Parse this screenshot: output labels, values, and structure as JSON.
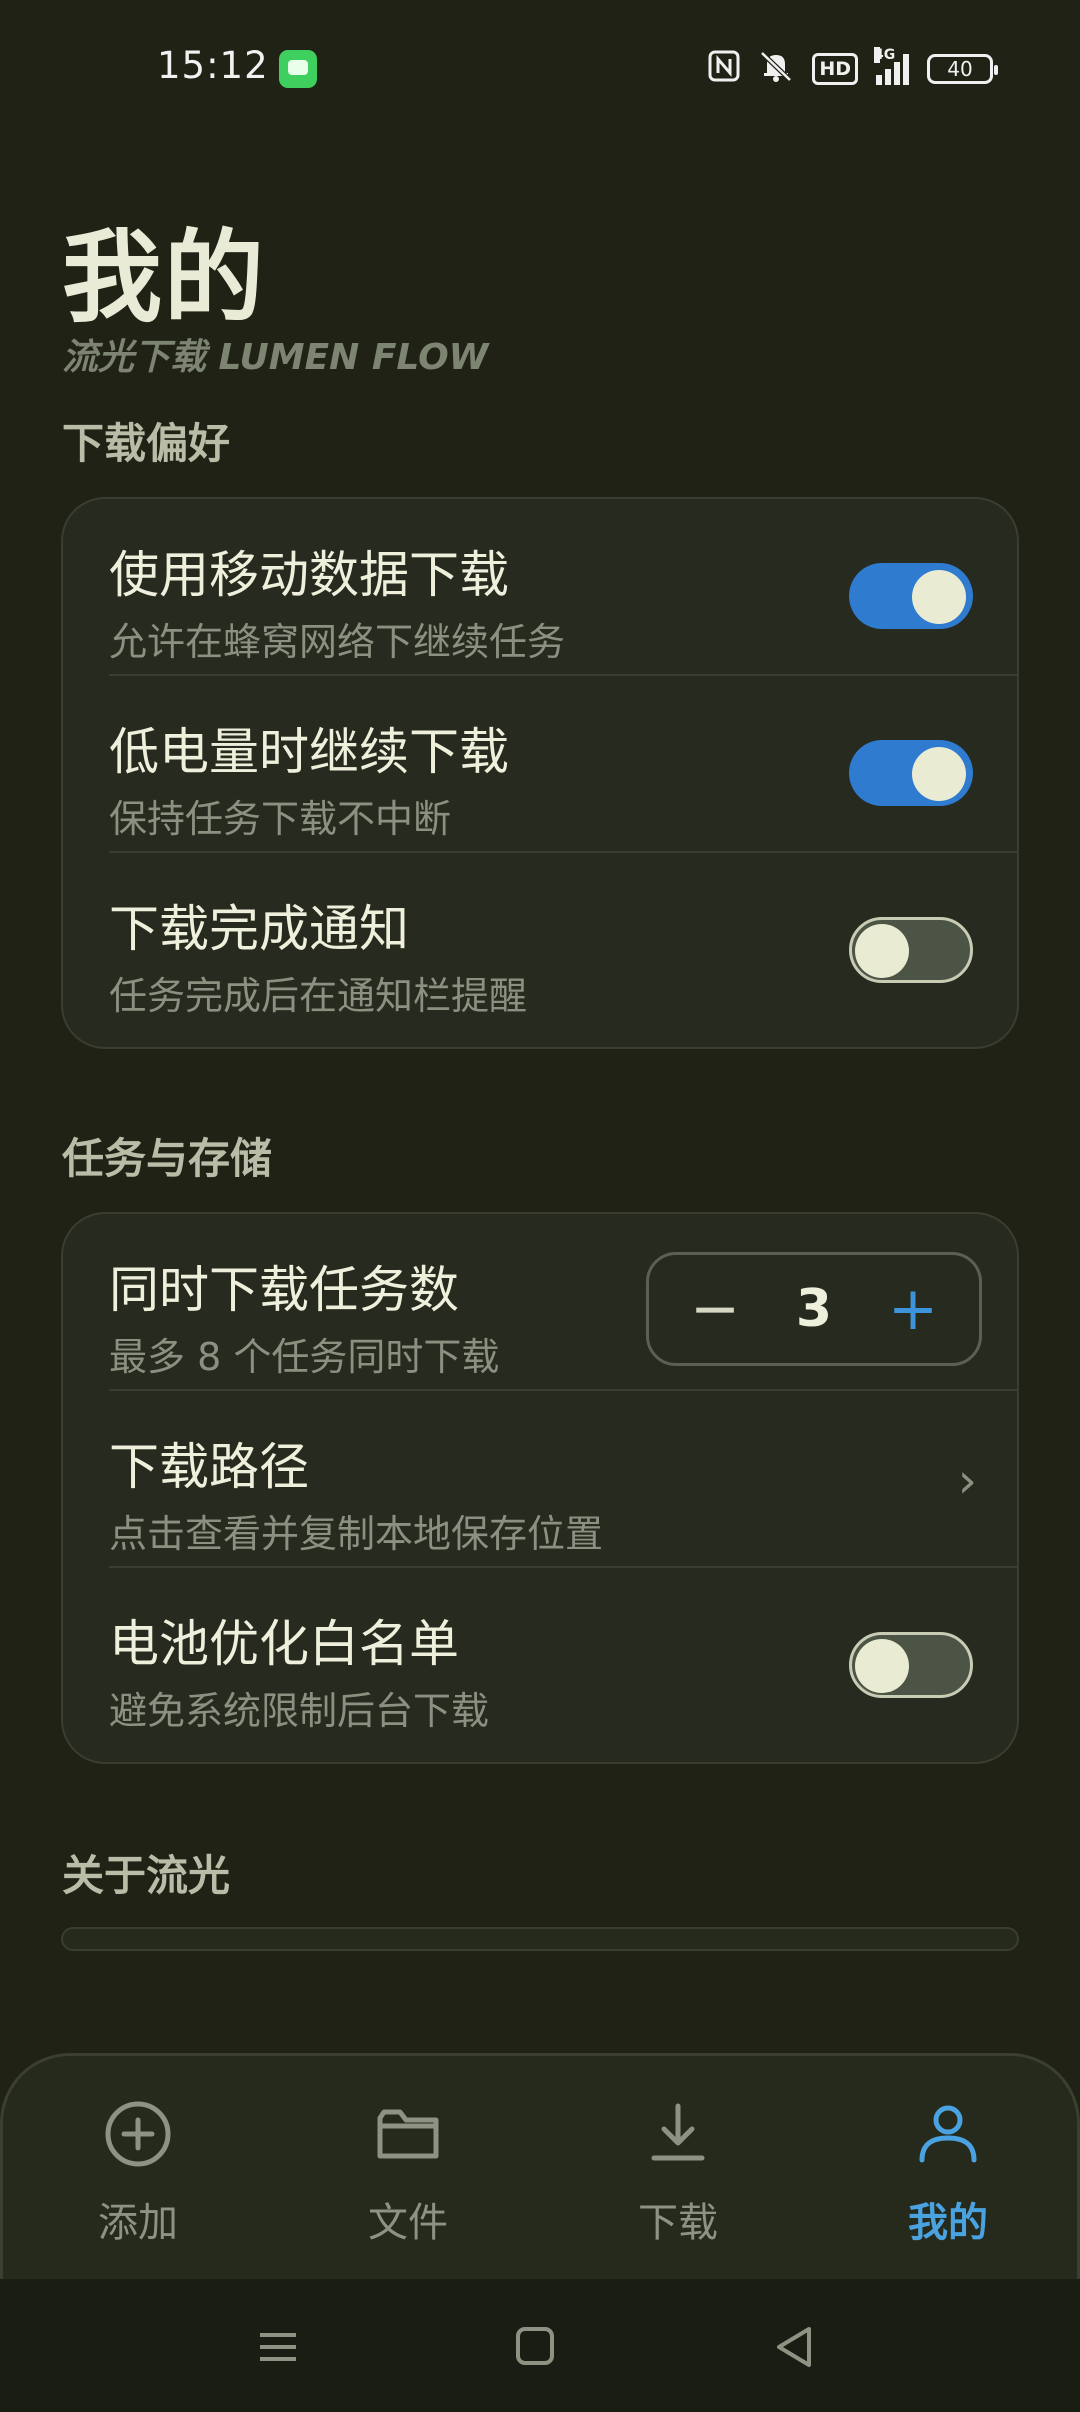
{
  "status_bar": {
    "time": "15:12",
    "hd": "HD",
    "network": "4G",
    "battery": "40"
  },
  "header": {
    "title": "我的",
    "subtitle": "流光下载  LUMEN FLOW"
  },
  "sections": {
    "download_prefs": {
      "title": "下载偏好",
      "rows": [
        {
          "title": "使用移动数据下载",
          "subtitle": "允许在蜂窝网络下继续任务",
          "enabled": true
        },
        {
          "title": "低电量时继续下载",
          "subtitle": "保持任务下载不中断",
          "enabled": true
        },
        {
          "title": "下载完成通知",
          "subtitle": "任务完成后在通知栏提醒",
          "enabled": false
        }
      ]
    },
    "tasks_storage": {
      "title": "任务与存储",
      "concurrent": {
        "title": "同时下载任务数",
        "subtitle": "最多 8 个任务同时下载",
        "value": "3",
        "minus": "−",
        "plus": "+"
      },
      "path": {
        "title": "下载路径",
        "subtitle": "点击查看并复制本地保存位置",
        "chevron": "›"
      },
      "battery_whitelist": {
        "title": "电池优化白名单",
        "subtitle": "避免系统限制后台下载",
        "enabled": false
      }
    },
    "about": {
      "title": "关于流光"
    }
  },
  "bottom_nav": {
    "items": [
      {
        "label": "添加",
        "icon": "add-circle-icon"
      },
      {
        "label": "文件",
        "icon": "folder-icon"
      },
      {
        "label": "下载",
        "icon": "download-icon"
      },
      {
        "label": "我的",
        "icon": "person-icon",
        "active": true
      }
    ]
  },
  "colors": {
    "background": "#1f2215",
    "accent": "#2e7bd0",
    "active_nav": "#4aa3e0"
  }
}
